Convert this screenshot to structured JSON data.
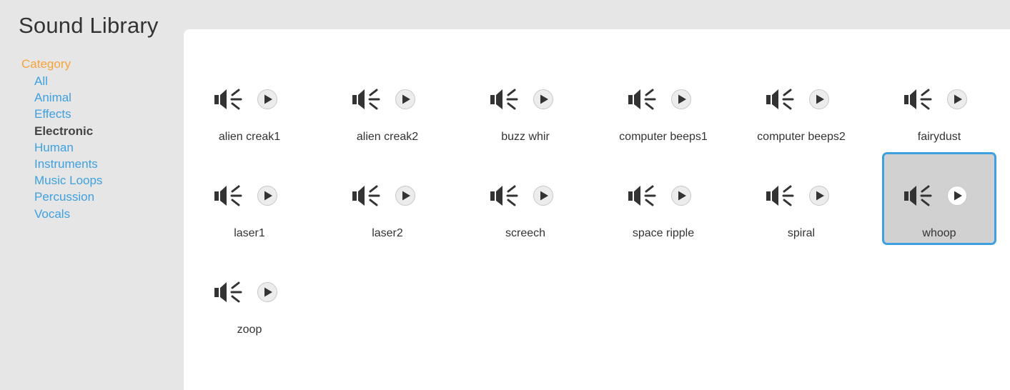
{
  "title": "Sound Library",
  "sidebar": {
    "heading": "Category",
    "categories": [
      "All",
      "Animal",
      "Effects",
      "Electronic",
      "Human",
      "Instruments",
      "Music Loops",
      "Percussion",
      "Vocals"
    ],
    "selected": "Electronic"
  },
  "colors": {
    "accent_orange": "#f7a33b",
    "link_blue": "#3fa0e0",
    "selection_border": "#3ea0e0",
    "selection_bg": "#d1d1d1"
  },
  "sounds": [
    {
      "name": "alien creak1"
    },
    {
      "name": "alien creak2"
    },
    {
      "name": "buzz whir"
    },
    {
      "name": "computer beeps1"
    },
    {
      "name": "computer beeps2"
    },
    {
      "name": "fairydust"
    },
    {
      "name": "laser1"
    },
    {
      "name": "laser2"
    },
    {
      "name": "screech"
    },
    {
      "name": "space ripple"
    },
    {
      "name": "spiral"
    },
    {
      "name": "whoop",
      "selected": true
    },
    {
      "name": "zoop"
    }
  ],
  "icons": {
    "speaker": "speaker-icon",
    "play": "play-icon"
  }
}
